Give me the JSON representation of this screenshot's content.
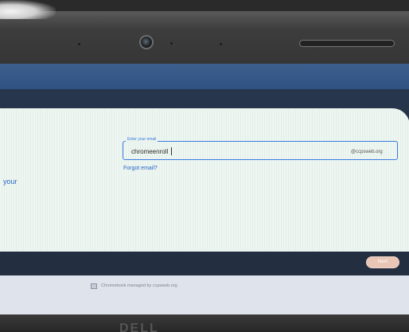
{
  "signin": {
    "email_label": "Enter your email",
    "email_value": "chromeenroll",
    "email_suffix": "@ccpsweb.org",
    "forgot_email": "Forgot email?",
    "left_link_fragment": "your",
    "next_label": "Next"
  },
  "footer": {
    "managed_text": "Chromebook managed by ccpsweb.org"
  },
  "device": {
    "brand": "DELL"
  },
  "colors": {
    "accent": "#3a7be0",
    "link": "#2a66c8",
    "next_button": "#e8c5b4"
  },
  "icons": {
    "managed": "enterprise-building-icon"
  }
}
